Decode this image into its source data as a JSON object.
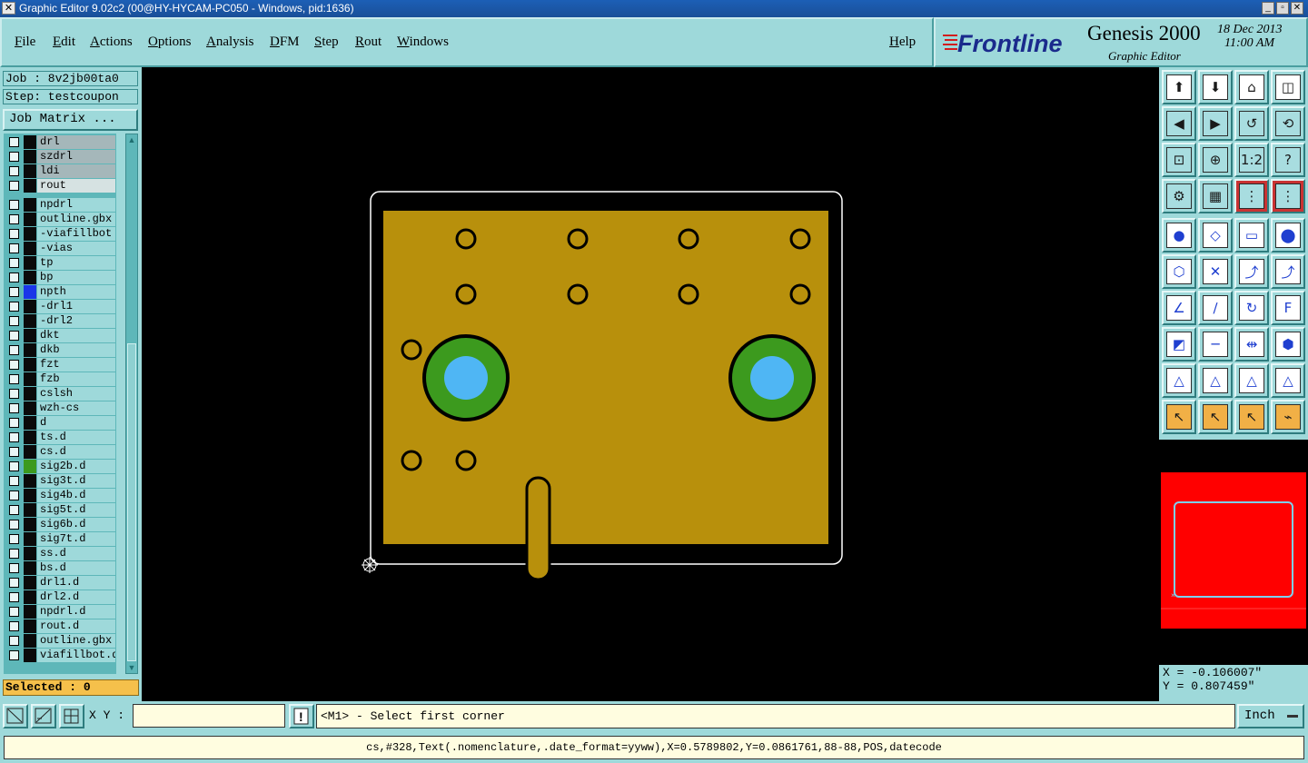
{
  "window": {
    "title": "Graphic Editor 9.02c2 (00@HY-HYCAM-PC050 - Windows, pid:1636)"
  },
  "menu": {
    "items": [
      "File",
      "Edit",
      "Actions",
      "Options",
      "Analysis",
      "DFM",
      "Step",
      "Rout",
      "Windows"
    ],
    "help": "Help"
  },
  "logo": {
    "brand": "Frontline",
    "product": "Genesis 2000",
    "subtitle": "Graphic Editor",
    "date": "18 Dec 2013",
    "time": "11:00 AM"
  },
  "job": {
    "job_label": "Job : 8v2jb00ta0",
    "step_label": "Step: testcoupon",
    "matrix_button": "Job Matrix ..."
  },
  "layers": [
    {
      "name": "drl",
      "color": "#0a0a0a",
      "dim": true
    },
    {
      "name": "szdrl",
      "color": "#0a0a0a",
      "dim": true
    },
    {
      "name": "ldi",
      "color": "#0a0a0a",
      "dim": true
    },
    {
      "name": "rout",
      "color": "#0a0a0a",
      "dim": true,
      "light": true
    },
    {
      "name": "npdrl",
      "color": "#0a0a0a"
    },
    {
      "name": "outline.gbx",
      "color": "#0a0a0a"
    },
    {
      "name": "-viafillbot",
      "color": "#0a0a0a"
    },
    {
      "name": "-vias",
      "color": "#0a0a0a"
    },
    {
      "name": "tp",
      "color": "#0a0a0a"
    },
    {
      "name": "bp",
      "color": "#0a0a0a"
    },
    {
      "name": "npth",
      "color": "#1a35e8"
    },
    {
      "name": "-drl1",
      "color": "#0a0a0a"
    },
    {
      "name": "-drl2",
      "color": "#0a0a0a"
    },
    {
      "name": "dkt",
      "color": "#0a0a0a"
    },
    {
      "name": "dkb",
      "color": "#0a0a0a"
    },
    {
      "name": "fzt",
      "color": "#0a0a0a"
    },
    {
      "name": "fzb",
      "color": "#0a0a0a"
    },
    {
      "name": "cslsh",
      "color": "#0a0a0a"
    },
    {
      "name": "wzh-cs",
      "color": "#0a0a0a"
    },
    {
      "name": "d",
      "color": "#0a0a0a"
    },
    {
      "name": "ts.d",
      "color": "#0a0a0a"
    },
    {
      "name": "cs.d",
      "color": "#0a0a0a"
    },
    {
      "name": "sig2b.d",
      "color": "#3c9a1e"
    },
    {
      "name": "sig3t.d",
      "color": "#0a0a0a"
    },
    {
      "name": "sig4b.d",
      "color": "#0a0a0a"
    },
    {
      "name": "sig5t.d",
      "color": "#0a0a0a"
    },
    {
      "name": "sig6b.d",
      "color": "#0a0a0a"
    },
    {
      "name": "sig7t.d",
      "color": "#0a0a0a"
    },
    {
      "name": "ss.d",
      "color": "#0a0a0a"
    },
    {
      "name": "bs.d",
      "color": "#0a0a0a"
    },
    {
      "name": "drl1.d",
      "color": "#0a0a0a"
    },
    {
      "name": "drl2.d",
      "color": "#0a0a0a"
    },
    {
      "name": "npdrl.d",
      "color": "#0a0a0a"
    },
    {
      "name": "rout.d",
      "color": "#0a0a0a"
    },
    {
      "name": "outline.gbx",
      "color": "#0a0a0a"
    },
    {
      "name": "viafillbot.d",
      "color": "#0a0a0a"
    }
  ],
  "selected": "Selected : 0",
  "coordinates": {
    "x": "X = -0.106007\"",
    "y": "Y = 0.807459\""
  },
  "bottom": {
    "xy_label": "X Y :",
    "xy_value": "",
    "prompt": "<M1> - Select first corner",
    "units": "Inch",
    "status": "cs,#328,Text(.nomenclature,.date_format=yyww),X=0.5789802,Y=0.0861761,88-88,POS,datecode"
  },
  "colors": {
    "board": "#b8900c",
    "pad_ring": "#3c9a1e",
    "hole": "#4fb6f4",
    "panel": "#9ed9da",
    "overview_red": "#ff0000"
  }
}
